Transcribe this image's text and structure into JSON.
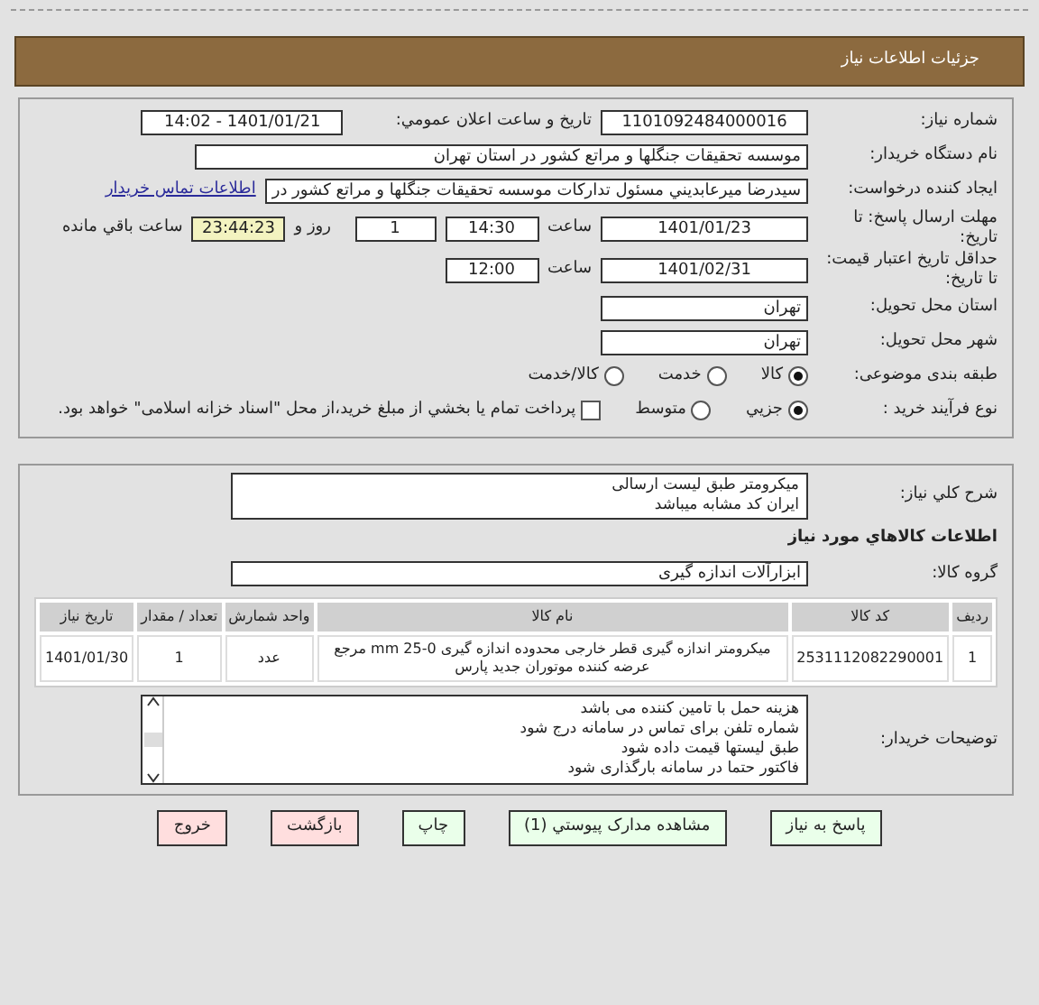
{
  "header": {
    "title": "جزئيات اطلاعات نياز"
  },
  "need_number": {
    "label": "شماره نياز:",
    "value": "1101092484000016"
  },
  "announce": {
    "label": "تاريخ و ساعت اعلان عمومي:",
    "value": "1401/01/21 - 14:02"
  },
  "buyer": {
    "label": "نام دستگاه خريدار:",
    "value": "موسسه تحقيقات جنگلها و مراتع کشور در استان تهران"
  },
  "creator": {
    "label": "ايجاد کننده درخواست:",
    "value": "سيدرضا ميرعابديني مسئول تدارکات موسسه تحقيقات جنگلها و مراتع کشور در",
    "link": "اطلاعات تماس خريدار"
  },
  "deadline": {
    "label": "مهلت ارسال پاسخ: تا تاريخ:",
    "date": "1401/01/23",
    "time_label": "ساعت",
    "time": "14:30",
    "days": "1",
    "days_label": "روز و",
    "remaining": "23:44:23",
    "remaining_label": "ساعت باقي مانده"
  },
  "validity": {
    "label": "حداقل تاريخ اعتبار قيمت: تا تاريخ:",
    "date": "1401/02/31",
    "time_label": "ساعت",
    "time": "12:00"
  },
  "province": {
    "label": "استان محل تحويل:",
    "value": "تهران"
  },
  "city": {
    "label": "شهر محل تحويل:",
    "value": "تهران"
  },
  "category": {
    "label": "طبقه بندی موضوعی:",
    "options": [
      {
        "label": "کالا",
        "selected": true
      },
      {
        "label": "خدمت",
        "selected": false
      },
      {
        "label": "کالا/خدمت",
        "selected": false
      }
    ]
  },
  "process": {
    "label": "نوع فرآيند خريد :",
    "options": [
      {
        "label": "جزيي",
        "selected": true
      },
      {
        "label": "متوسط",
        "selected": false
      }
    ],
    "payment": {
      "checked": false,
      "label": "پرداخت تمام يا بخشي از مبلغ خريد،از محل \"اسناد خزانه اسلامی\" خواهد بود."
    }
  },
  "description": {
    "label": "شرح کلي نياز:",
    "lines": [
      "ميکرومتر طبق ليست ارسالی",
      "ايران کد مشابه ميباشد"
    ]
  },
  "goods_heading": "اطلاعات کالاهاي مورد نياز",
  "goods_group": {
    "label": "گروه کالا:",
    "value": "ابزارآلات اندازه گيری"
  },
  "table": {
    "columns": [
      "رديف",
      "کد کالا",
      "نام کالا",
      "واحد شمارش",
      "تعداد / مقدار",
      "تاريخ نياز"
    ],
    "rows": [
      [
        "1",
        "2531112082290001",
        "ميکرومتر اندازه گيری قطر خارجی محدوده اندازه گيری 0-25 mm مرجع عرضه کننده موتوران جديد پارس",
        "عدد",
        "1",
        "1401/01/30"
      ]
    ]
  },
  "buyer_notes": {
    "label": "توضيحات خريدار:",
    "lines": [
      "هزينه حمل با تامين کننده می باشد",
      "شماره تلفن برای تماس در سامانه درج شود",
      "طبق ليستها قيمت داده شود",
      "فاکتور حتما در سامانه بارگذاری شود"
    ]
  },
  "buttons": [
    {
      "label": "پاسخ به نياز",
      "kind": "normal"
    },
    {
      "label": "مشاهده مدارک پيوستي (1)",
      "kind": "normal"
    },
    {
      "label": "چاپ",
      "kind": "normal"
    },
    {
      "label": "بازگشت",
      "kind": "alert"
    },
    {
      "label": "خروج",
      "kind": "alert"
    }
  ]
}
